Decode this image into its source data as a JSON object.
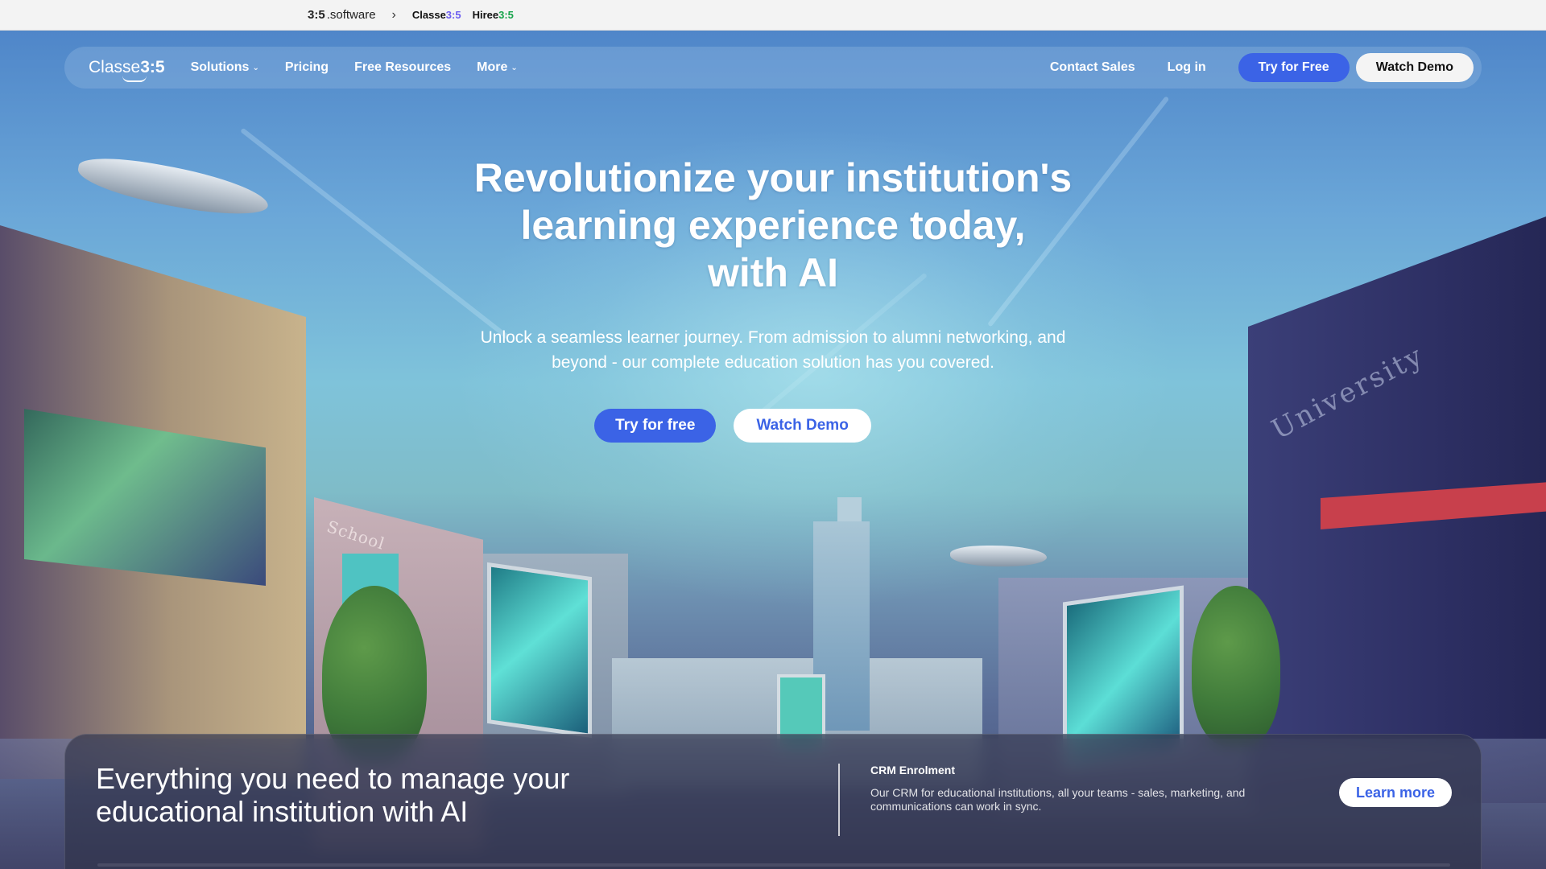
{
  "topbar": {
    "brand_software_mark": "3:5",
    "brand_software_text": ".software",
    "chevron": "›",
    "brand_classe_text": "Classe",
    "brand_classe_accent": "3:5",
    "brand_hiree_text": "Hiree",
    "brand_hiree_accent": "3:5"
  },
  "nav": {
    "logo_text": "Classe",
    "logo_num": "3:5",
    "links": [
      {
        "label": "Solutions",
        "has_caret": true
      },
      {
        "label": "Pricing",
        "has_caret": false
      },
      {
        "label": "Free Resources",
        "has_caret": false
      },
      {
        "label": "More",
        "has_caret": true
      }
    ],
    "contact_sales": "Contact Sales",
    "log_in": "Log in",
    "try_free": "Try for Free",
    "watch_demo": "Watch Demo"
  },
  "hero": {
    "headline_line1": "Revolutionize your institution's",
    "headline_line2": "learning experience today,",
    "headline_line3": "with AI",
    "subline_line1": "Unlock a seamless learner journey. From admission to alumni networking, and",
    "subline_line2": "beyond - our complete education solution has you covered.",
    "cta_primary": "Try for free",
    "cta_secondary": "Watch Demo",
    "sign_school": "School",
    "sign_university": "University"
  },
  "card": {
    "title_line1": "Everything you need to manage your",
    "title_line2": "educational institution with AI",
    "item_title": "CRM Enrolment",
    "item_desc_line1": "Our CRM for educational institutions, all your teams - sales, marketing, and",
    "item_desc_line2": "communications can work in sync.",
    "learn_more": "Learn more"
  },
  "colors": {
    "accent_blue": "#3b63e6",
    "classe_accent": "#6b5cf0",
    "hiree_accent": "#16a34a"
  }
}
